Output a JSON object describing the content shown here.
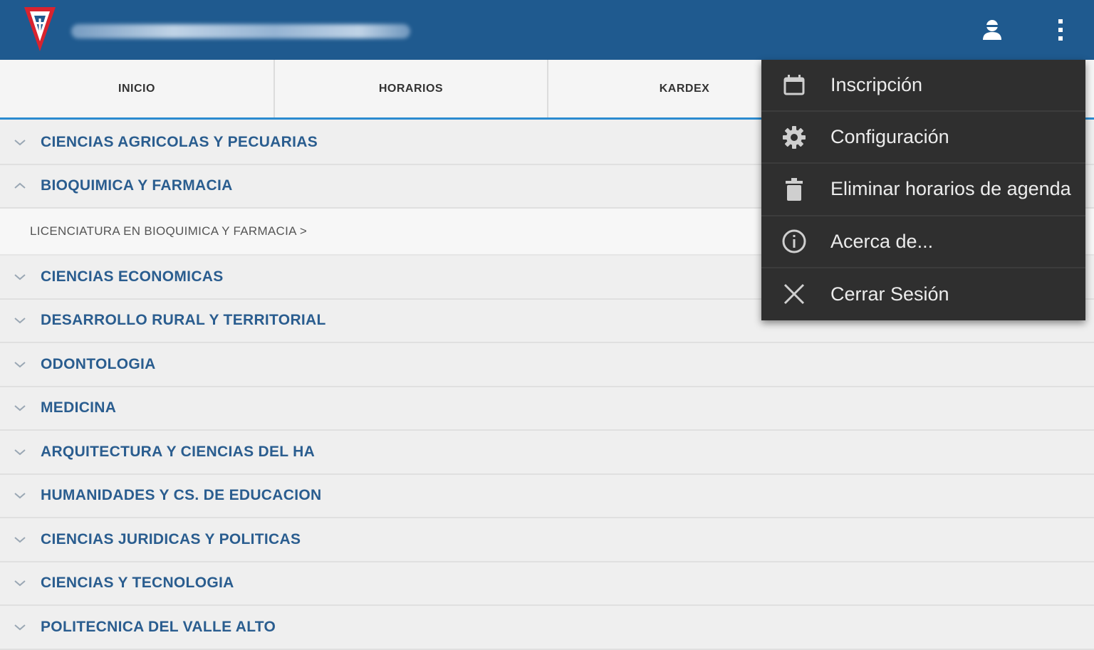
{
  "tabs": [
    {
      "label": "INICIO"
    },
    {
      "label": "HORARIOS"
    },
    {
      "label": "KARDEX"
    },
    {
      "label": ""
    }
  ],
  "list": {
    "faculties": [
      {
        "label": "CIENCIAS AGRICOLAS Y PECUARIAS",
        "expanded": false
      },
      {
        "label": "BIOQUIMICA Y FARMACIA",
        "expanded": true
      },
      {
        "label": "CIENCIAS ECONOMICAS",
        "expanded": false
      },
      {
        "label": "DESARROLLO RURAL Y TERRITORIAL",
        "expanded": false
      },
      {
        "label": "ODONTOLOGIA",
        "expanded": false
      },
      {
        "label": "MEDICINA",
        "expanded": false
      },
      {
        "label": "ARQUITECTURA Y CIENCIAS DEL HA",
        "expanded": false
      },
      {
        "label": "HUMANIDADES Y CS. DE EDUCACION",
        "expanded": false
      },
      {
        "label": "CIENCIAS JURIDICAS Y POLITICAS",
        "expanded": false
      },
      {
        "label": "CIENCIAS Y TECNOLOGIA",
        "expanded": false
      },
      {
        "label": "POLITECNICA DEL VALLE ALTO",
        "expanded": false
      }
    ],
    "subitem": "LICENCIATURA EN BIOQUIMICA Y FARMACIA >"
  },
  "menu": {
    "items": [
      {
        "label": "Inscripción",
        "icon": "calendar-icon"
      },
      {
        "label": "Configuración",
        "icon": "gear-icon"
      },
      {
        "label": "Eliminar horarios de agenda",
        "icon": "trash-icon"
      },
      {
        "label": "Acerca de...",
        "icon": "info-icon"
      },
      {
        "label": "Cerrar Sesión",
        "icon": "close-icon"
      }
    ]
  },
  "colors": {
    "appbar": "#1f5a8f",
    "accent": "#2b8bd0",
    "faculty_text": "#2a5d8f",
    "menu_bg": "#2f2f2f"
  }
}
